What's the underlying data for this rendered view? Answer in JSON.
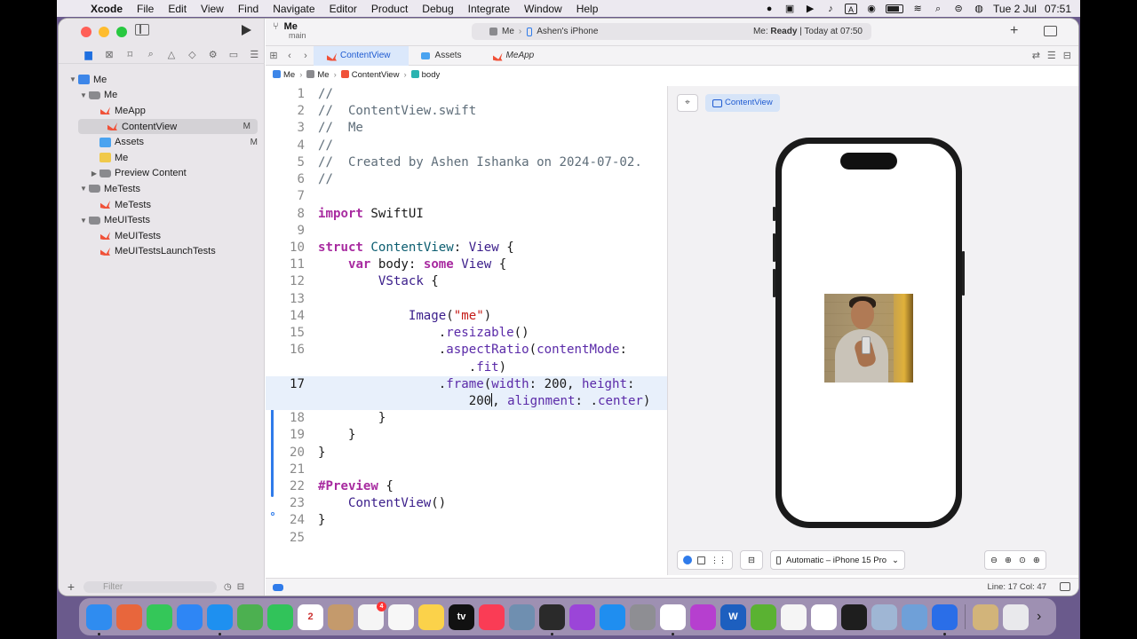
{
  "menubar": {
    "app": "Xcode",
    "items": [
      "File",
      "Edit",
      "View",
      "Find",
      "Navigate",
      "Editor",
      "Product",
      "Debug",
      "Integrate",
      "Window",
      "Help"
    ],
    "date": "Tue 2 Jul",
    "time": "07:51",
    "input_indicator": "A"
  },
  "toolbar": {
    "project_name": "Me",
    "branch": "main",
    "scheme": "Me",
    "destination": "Ashen's iPhone",
    "status_label": "Me:",
    "status_state": "Ready",
    "status_time": "| Today at 07:50"
  },
  "navigator": {
    "tree": [
      {
        "label": "Me",
        "icon": "project-icon",
        "depth": 0,
        "disclosure": "open",
        "badge": ""
      },
      {
        "label": "Me",
        "icon": "folder-icon",
        "depth": 1,
        "disclosure": "open",
        "badge": ""
      },
      {
        "label": "MeApp",
        "icon": "swift-icon",
        "depth": 2,
        "disclosure": "",
        "badge": ""
      },
      {
        "label": "ContentView",
        "icon": "swift-icon",
        "depth": 2,
        "disclosure": "",
        "badge": "M",
        "selected": true
      },
      {
        "label": "Assets",
        "icon": "assets-icon",
        "depth": 2,
        "disclosure": "",
        "badge": "M"
      },
      {
        "label": "Me",
        "icon": "entitlements-icon",
        "depth": 2,
        "disclosure": "",
        "badge": ""
      },
      {
        "label": "Preview Content",
        "icon": "folder-icon",
        "depth": 2,
        "disclosure": "closed",
        "badge": ""
      },
      {
        "label": "MeTests",
        "icon": "folder-icon",
        "depth": 1,
        "disclosure": "open",
        "badge": ""
      },
      {
        "label": "MeTests",
        "icon": "swift-icon",
        "depth": 2,
        "disclosure": "",
        "badge": ""
      },
      {
        "label": "MeUITests",
        "icon": "folder-icon",
        "depth": 1,
        "disclosure": "open",
        "badge": ""
      },
      {
        "label": "MeUITests",
        "icon": "swift-icon",
        "depth": 2,
        "disclosure": "",
        "badge": ""
      },
      {
        "label": "MeUITestsLaunchTests",
        "icon": "swift-icon",
        "depth": 2,
        "disclosure": "",
        "badge": ""
      }
    ],
    "filter_placeholder": "Filter"
  },
  "tabs": [
    {
      "label": "ContentView",
      "active": true,
      "icon": "swift-icon"
    },
    {
      "label": "Assets",
      "active": false,
      "icon": "assets-icon"
    },
    {
      "label": "MeApp",
      "active": false,
      "icon": "swift-icon",
      "italic": true
    }
  ],
  "jumpbar": [
    "Me",
    "Me",
    "ContentView",
    "body"
  ],
  "code": {
    "current_line": 17,
    "lines": [
      [
        [
          "cm",
          "//"
        ]
      ],
      [
        [
          "cm",
          "//  ContentView.swift"
        ]
      ],
      [
        [
          "cm",
          "//  Me"
        ]
      ],
      [
        [
          "cm",
          "//"
        ]
      ],
      [
        [
          "cm",
          "//  Created by Ashen Ishanka on 2024-07-02."
        ]
      ],
      [
        [
          "cm",
          "//"
        ]
      ],
      [],
      [
        [
          "kw",
          "import"
        ],
        [
          "",
          " SwiftUI"
        ]
      ],
      [],
      [
        [
          "kw",
          "struct"
        ],
        [
          "",
          " "
        ],
        [
          "tyd",
          "ContentView"
        ],
        [
          "",
          ": "
        ],
        [
          "ty",
          "View"
        ],
        [
          "",
          " {"
        ]
      ],
      [
        [
          "",
          "    "
        ],
        [
          "kw",
          "var"
        ],
        [
          "",
          " body: "
        ],
        [
          "kw",
          "some"
        ],
        [
          "",
          " "
        ],
        [
          "ty",
          "View"
        ],
        [
          "",
          " {"
        ]
      ],
      [
        [
          "",
          "        "
        ],
        [
          "ty",
          "VStack"
        ],
        [
          "",
          " {"
        ]
      ],
      [],
      [
        [
          "",
          "            "
        ],
        [
          "ty",
          "Image"
        ],
        [
          "",
          "("
        ],
        [
          "str",
          "\"me\""
        ],
        [
          "",
          ")"
        ]
      ],
      [
        [
          "",
          "                ."
        ],
        [
          "fn",
          "resizable"
        ],
        [
          "",
          "()"
        ]
      ],
      [
        [
          "",
          "                ."
        ],
        [
          "fn",
          "aspectRatio"
        ],
        [
          "",
          "("
        ],
        [
          "fn",
          "contentMode"
        ],
        [
          "",
          ":"
        ]
      ],
      [
        [
          "",
          "                    ."
        ],
        [
          "fn",
          "fit"
        ],
        [
          "",
          ")"
        ]
      ],
      [
        [
          "",
          "                ."
        ],
        [
          "fn",
          "frame"
        ],
        [
          "",
          "("
        ],
        [
          "fn",
          "width"
        ],
        [
          "",
          ": 200, "
        ],
        [
          "fn",
          "height"
        ],
        [
          "",
          ":"
        ]
      ],
      [
        [
          "",
          "                    200"
        ],
        [
          "caret",
          ""
        ],
        [
          "",
          ", "
        ],
        [
          "fn",
          "alignment"
        ],
        [
          "",
          ": ."
        ],
        [
          "fn",
          "center"
        ],
        [
          "",
          ")"
        ]
      ],
      [
        [
          "",
          "        }"
        ]
      ],
      [
        [
          "",
          "    }"
        ]
      ],
      [
        [
          "",
          "}"
        ]
      ],
      [],
      [
        [
          "kw",
          "#Preview"
        ],
        [
          "",
          " {"
        ]
      ],
      [
        [
          "",
          "    "
        ],
        [
          "ty",
          "ContentView"
        ],
        [
          "",
          "()"
        ]
      ],
      [
        [
          "",
          "}"
        ]
      ],
      []
    ],
    "line_numbers": [
      "1",
      "2",
      "3",
      "4",
      "5",
      "6",
      "7",
      "8",
      "9",
      "10",
      "11",
      "12",
      "13",
      "14",
      "15",
      "16",
      "",
      "17",
      "",
      "18",
      "19",
      "20",
      "21",
      "22",
      "23",
      "24",
      "25"
    ]
  },
  "canvas": {
    "chip_label": "ContentView",
    "device_label": "Automatic – iPhone 15 Pro"
  },
  "statusbar": {
    "position": "Line: 17  Col: 47"
  },
  "dock": {
    "apps": [
      {
        "name": "finder-icon",
        "color": "#2f8cf0",
        "running": true
      },
      {
        "name": "launchpad-icon",
        "color": "#e8663c",
        "running": false
      },
      {
        "name": "messages-icon",
        "color": "#34c759",
        "running": false
      },
      {
        "name": "mail-icon",
        "color": "#2e86f5",
        "running": false
      },
      {
        "name": "safari-icon",
        "color": "#1e90f0",
        "running": true
      },
      {
        "name": "maps-icon",
        "color": "#4cb050",
        "running": false
      },
      {
        "name": "facetime-icon",
        "color": "#31c35a",
        "running": false
      },
      {
        "name": "calendar-icon",
        "color": "#ffffff",
        "running": false,
        "text": "2"
      },
      {
        "name": "contacts-icon",
        "color": "#c49a6c",
        "running": false
      },
      {
        "name": "reminders-icon",
        "color": "#f5f5f5",
        "running": false,
        "badge": "4"
      },
      {
        "name": "freeform-icon",
        "color": "#f7f7f7",
        "running": false
      },
      {
        "name": "notes-icon",
        "color": "#fbd24a",
        "running": false
      },
      {
        "name": "apple-tv-icon",
        "color": "#111111",
        "running": false,
        "text": "tv"
      },
      {
        "name": "music-icon",
        "color": "#fa3c55",
        "running": false
      },
      {
        "name": "quicktime-icon",
        "color": "#6f8fb0",
        "running": false
      },
      {
        "name": "obs-icon",
        "color": "#2a2a2a",
        "running": true
      },
      {
        "name": "podcasts-icon",
        "color": "#9b45d8",
        "running": false
      },
      {
        "name": "app-store-icon",
        "color": "#1f8ef0",
        "running": false
      },
      {
        "name": "system-settings-icon",
        "color": "#8e8e93",
        "running": false
      },
      {
        "name": "chrome-icon",
        "color": "#ffffff",
        "running": true
      },
      {
        "name": "speeko-icon",
        "color": "#b63fcf",
        "running": false
      },
      {
        "name": "word-icon",
        "color": "#1d5fbf",
        "running": false,
        "text": "W"
      },
      {
        "name": "utorrent-icon",
        "color": "#5ab232",
        "running": false
      },
      {
        "name": "brave-icon",
        "color": "#f5f5f5",
        "running": false
      },
      {
        "name": "clock-icon",
        "color": "#ffffff",
        "running": false
      },
      {
        "name": "terminal-icon",
        "color": "#1e1e1e",
        "running": false
      },
      {
        "name": "preview-icon",
        "color": "#9fb6d4",
        "running": false
      },
      {
        "name": "finder-utility-icon",
        "color": "#6fa0d8",
        "running": false
      },
      {
        "name": "xcode-icon",
        "color": "#2a6ee8",
        "running": true
      }
    ],
    "recent": [
      {
        "name": "photo-thumbnail-icon",
        "color": "#d2b47a"
      },
      {
        "name": "trash-icon",
        "color": "#e9e9ec"
      }
    ]
  }
}
